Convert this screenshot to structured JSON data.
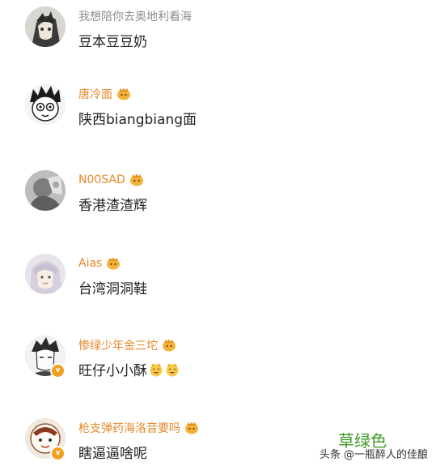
{
  "comments": [
    {
      "username": "我想陪你去奥地利看海",
      "username_style": "gray",
      "has_crown": false,
      "text": "豆本豆豆奶",
      "emojis": 0,
      "verified": false,
      "avatar": "anime-avatar"
    },
    {
      "username": "唐冷面",
      "username_style": "gold",
      "has_crown": true,
      "text": "陕西biangbiang面",
      "emojis": 0,
      "verified": false,
      "avatar": "cartoon-boy-avatar"
    },
    {
      "username": "N00SAD",
      "username_style": "gold",
      "has_crown": true,
      "text": "香港渣渣辉",
      "emojis": 0,
      "verified": false,
      "avatar": "gray-photo-avatar"
    },
    {
      "username": "Aias",
      "username_style": "gold",
      "has_crown": true,
      "text": "台湾洞洞鞋",
      "emojis": 0,
      "verified": false,
      "avatar": "girl-avatar"
    },
    {
      "username": "惨绿少年金三坨",
      "username_style": "gold",
      "has_crown": true,
      "text": "旺仔小小酥",
      "emojis": 2,
      "verified": true,
      "avatar": "sketch-avatar"
    },
    {
      "username": "枪支弹药海洛音要吗",
      "username_style": "gold",
      "has_crown": true,
      "text": "瞎逼逼啥呢",
      "emojis": 0,
      "verified": true,
      "avatar": "orange-avatar"
    }
  ],
  "watermark": {
    "green_text": "草绿色",
    "text": "头条 @一瓶醉人的佳酿"
  },
  "colors": {
    "gold_username": "#e5892a",
    "gray_username": "#8c8c8c",
    "watermark_green": "#3f9a25"
  }
}
